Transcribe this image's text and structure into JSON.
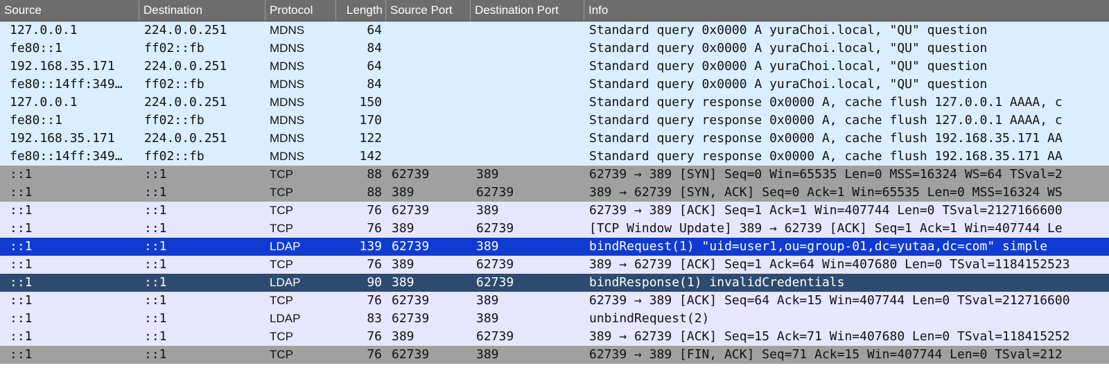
{
  "columns": {
    "source": "Source",
    "destination": "Destination",
    "protocol": "Protocol",
    "length": "Length",
    "source_port": "Source Port",
    "destination_port": "Destination Port",
    "info": "Info"
  },
  "packets": [
    {
      "source": "127.0.0.1",
      "destination": "224.0.0.251",
      "protocol": "MDNS",
      "length": "64",
      "source_port": "",
      "destination_port": "",
      "info": "Standard query 0x0000 A yuraChoi.local, \"QU\" question",
      "style": "mdns"
    },
    {
      "source": "fe80::1",
      "destination": "ff02::fb",
      "protocol": "MDNS",
      "length": "84",
      "source_port": "",
      "destination_port": "",
      "info": "Standard query 0x0000 A yuraChoi.local, \"QU\" question",
      "style": "mdns"
    },
    {
      "source": "192.168.35.171",
      "destination": "224.0.0.251",
      "protocol": "MDNS",
      "length": "64",
      "source_port": "",
      "destination_port": "",
      "info": "Standard query 0x0000 A yuraChoi.local, \"QU\" question",
      "style": "mdns"
    },
    {
      "source": "fe80::14ff:349…",
      "destination": "ff02::fb",
      "protocol": "MDNS",
      "length": "84",
      "source_port": "",
      "destination_port": "",
      "info": "Standard query 0x0000 A yuraChoi.local, \"QU\" question",
      "style": "mdns"
    },
    {
      "source": "127.0.0.1",
      "destination": "224.0.0.251",
      "protocol": "MDNS",
      "length": "150",
      "source_port": "",
      "destination_port": "",
      "info": "Standard query response 0x0000 A, cache flush 127.0.0.1 AAAA, c",
      "style": "mdns"
    },
    {
      "source": "fe80::1",
      "destination": "ff02::fb",
      "protocol": "MDNS",
      "length": "170",
      "source_port": "",
      "destination_port": "",
      "info": "Standard query response 0x0000 A, cache flush 127.0.0.1 AAAA, c",
      "style": "mdns"
    },
    {
      "source": "192.168.35.171",
      "destination": "224.0.0.251",
      "protocol": "MDNS",
      "length": "122",
      "source_port": "",
      "destination_port": "",
      "info": "Standard query response 0x0000 A, cache flush 192.168.35.171 AA",
      "style": "mdns"
    },
    {
      "source": "fe80::14ff:349…",
      "destination": "ff02::fb",
      "protocol": "MDNS",
      "length": "142",
      "source_port": "",
      "destination_port": "",
      "info": "Standard query response 0x0000 A, cache flush 192.168.35.171 AA",
      "style": "mdns"
    },
    {
      "source": "::1",
      "destination": "::1",
      "protocol": "TCP",
      "length": "88",
      "source_port": "62739",
      "destination_port": "389",
      "info": "62739 → 389 [SYN] Seq=0 Win=65535 Len=0 MSS=16324 WS=64 TSval=2",
      "style": "tcp-dark"
    },
    {
      "source": "::1",
      "destination": "::1",
      "protocol": "TCP",
      "length": "88",
      "source_port": "389",
      "destination_port": "62739",
      "info": "389 → 62739 [SYN, ACK] Seq=0 Ack=1 Win=65535 Len=0 MSS=16324 WS",
      "style": "tcp-dark"
    },
    {
      "source": "::1",
      "destination": "::1",
      "protocol": "TCP",
      "length": "76",
      "source_port": "62739",
      "destination_port": "389",
      "info": "62739 → 389 [ACK] Seq=1 Ack=1 Win=407744 Len=0 TSval=2127166600",
      "style": "tcp-light"
    },
    {
      "source": "::1",
      "destination": "::1",
      "protocol": "TCP",
      "length": "76",
      "source_port": "389",
      "destination_port": "62739",
      "info": "[TCP Window Update] 389 → 62739 [ACK] Seq=1 Ack=1 Win=407744 Le",
      "style": "tcp-light"
    },
    {
      "source": "::1",
      "destination": "::1",
      "protocol": "LDAP",
      "length": "139",
      "source_port": "62739",
      "destination_port": "389",
      "info": "bindRequest(1) \"uid=user1,ou=group-01,dc=yutaa,dc=com\" simple",
      "style": "selected"
    },
    {
      "source": "::1",
      "destination": "::1",
      "protocol": "TCP",
      "length": "76",
      "source_port": "389",
      "destination_port": "62739",
      "info": "389 → 62739 [ACK] Seq=1 Ack=64 Win=407680 Len=0 TSval=1184152523",
      "style": "tcp-light"
    },
    {
      "source": "::1",
      "destination": "::1",
      "protocol": "LDAP",
      "length": "90",
      "source_port": "389",
      "destination_port": "62739",
      "info": "bindResponse(1) invalidCredentials",
      "style": "ldap-dark"
    },
    {
      "source": "::1",
      "destination": "::1",
      "protocol": "TCP",
      "length": "76",
      "source_port": "62739",
      "destination_port": "389",
      "info": "62739 → 389 [ACK] Seq=64 Ack=15 Win=407744 Len=0 TSval=212716600",
      "style": "tcp-light"
    },
    {
      "source": "::1",
      "destination": "::1",
      "protocol": "LDAP",
      "length": "83",
      "source_port": "62739",
      "destination_port": "389",
      "info": "unbindRequest(2)",
      "style": "ldap-light"
    },
    {
      "source": "::1",
      "destination": "::1",
      "protocol": "TCP",
      "length": "76",
      "source_port": "389",
      "destination_port": "62739",
      "info": "389 → 62739 [ACK] Seq=15 Ack=71 Win=407680 Len=0 TSval=118415252",
      "style": "tcp-light"
    },
    {
      "source": "::1",
      "destination": "::1",
      "protocol": "TCP",
      "length": "76",
      "source_port": "62739",
      "destination_port": "389",
      "info": "62739 → 389 [FIN, ACK] Seq=71 Ack=15 Win=407744 Len=0 TSval=212",
      "style": "tcp-dark"
    }
  ]
}
